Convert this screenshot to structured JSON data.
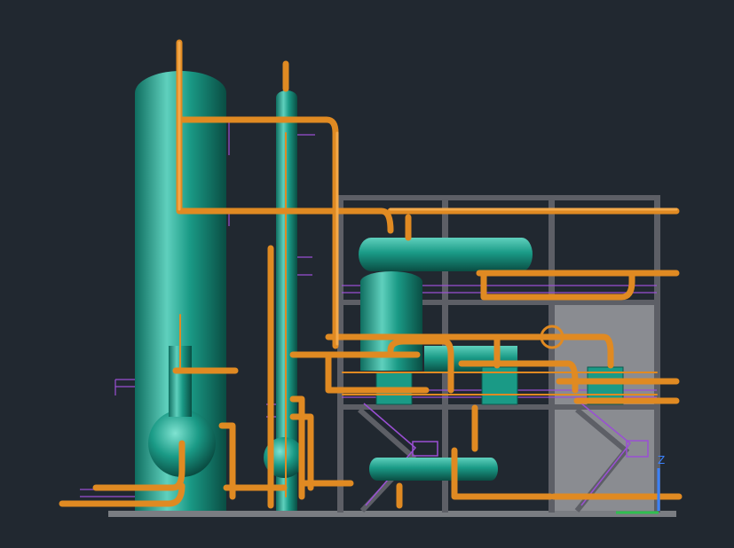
{
  "viewport": {
    "background": "#212830",
    "axis_label": "Z"
  },
  "colors": {
    "vessel": "#1a9a86",
    "vessel_highlight": "#5fd0bd",
    "vessel_shadow": "#0b5a4e",
    "pipe": "#e08a22",
    "pipe_highlight": "#ffc070",
    "structure": "#5d5f66",
    "wall": "#8a8c91",
    "grating": "#9a4fd4",
    "ground": "#7a7d82",
    "axis_z": "#3b82ff",
    "axis_x": "#2fbf4f"
  },
  "icons": [
    "axis-triad-icon"
  ]
}
